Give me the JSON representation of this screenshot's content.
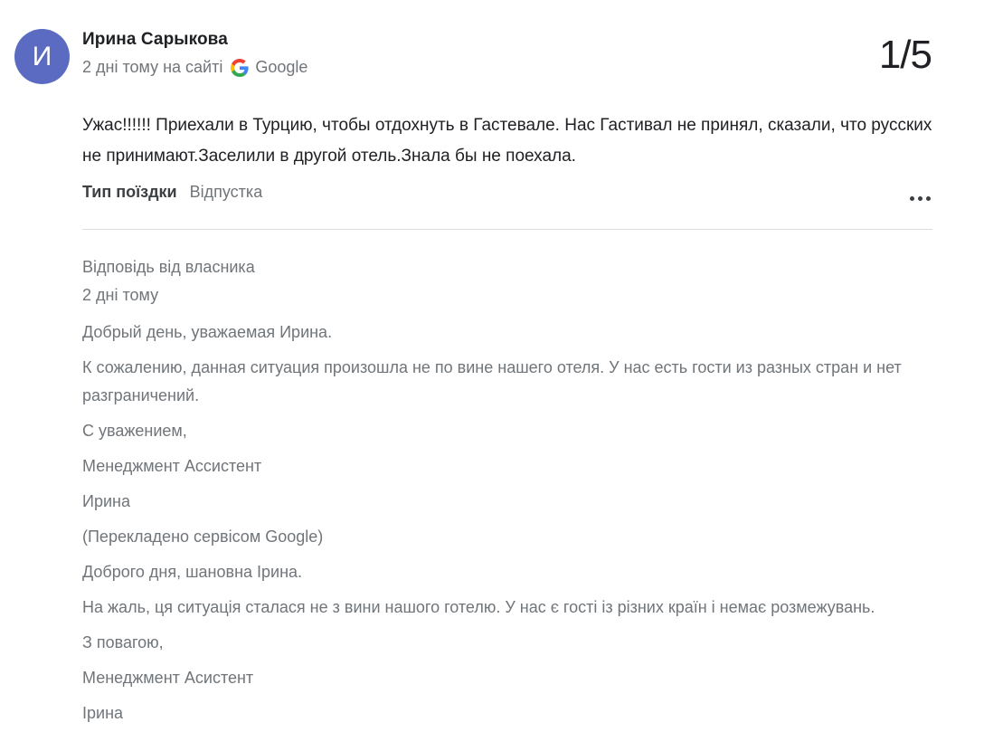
{
  "review": {
    "avatar_letter": "И",
    "author": "Ирина Сарыкова",
    "meta_time": "2 дні тому на сайті",
    "source": "Google",
    "rating": "1/5",
    "text": "Ужас!!!!!! Приехали в Турцию, чтобы отдохнуть в Гастевале. Нас Гастивал не принял, сказали, что русских не принимают.Заселили в другой отель.Знала бы не поехала.",
    "trip_label": "Тип поїздки",
    "trip_value": "Відпустка",
    "more_icon": "more-horiz-icon"
  },
  "owner_response": {
    "title": "Відповідь від власника",
    "time": "2 дні тому",
    "lines": [
      "Добрый день, уважаемая Ирина.",
      "К сожалению, данная ситуация произошла не по вине нашего отеля. У нас есть гости из разных стран и нет разграничений.",
      "С уважением,",
      "Менеджмент Ассистент",
      "Ирина",
      "(Перекладено сервісом Google)",
      "Доброго дня, шановна Ірина.",
      "На жаль, ця ситуація сталася не з вини нашого готелю. У нас є гості із різних країн і немає розмежувань.",
      "З повагою,",
      "Менеджмент Асистент",
      "Ірина"
    ]
  },
  "colors": {
    "avatar": "#5b6bc2",
    "muted_text": "#70757a",
    "divider": "#dadce0"
  }
}
